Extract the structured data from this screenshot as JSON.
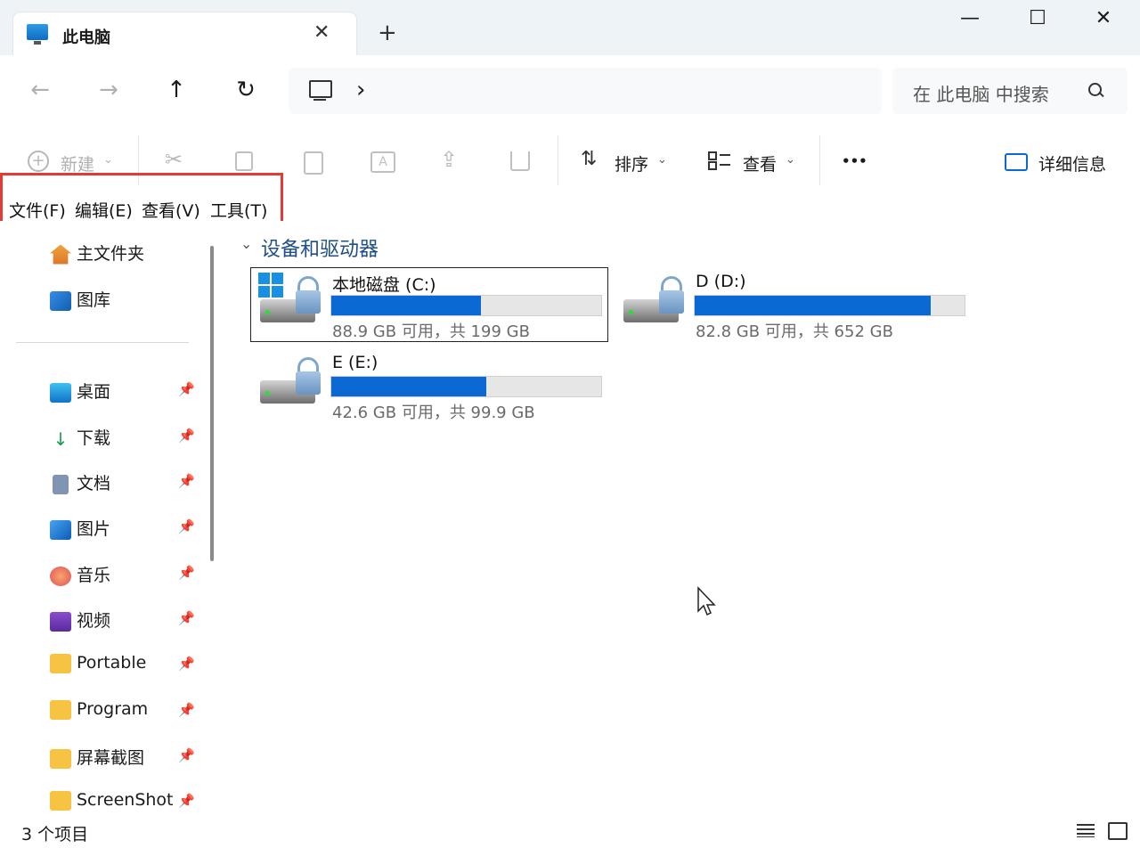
{
  "window": {
    "tab_title": "此电脑",
    "tab_close": "✕",
    "tab_add": "+",
    "minimize": "—",
    "maximize": "☐",
    "close": "✕"
  },
  "nav": {
    "back": "←",
    "forward": "→",
    "up": "↑",
    "refresh": "↻",
    "breadcrumb_sep": "›",
    "search_placeholder": "在 此电脑 中搜索"
  },
  "toolbar": {
    "new_label": "新建",
    "sort_label": "排序",
    "view_label": "查看",
    "more_label": "•••",
    "details_label": "详细信息"
  },
  "menubar": {
    "items": [
      "文件(F)",
      "编辑(E)",
      "查看(V)",
      "工具(T)"
    ]
  },
  "sidebar": {
    "items": [
      {
        "label": "主文件夹",
        "icon": "home-icon",
        "pinned": false
      },
      {
        "label": "图库",
        "icon": "gallery-icon",
        "pinned": false
      },
      {
        "label": "桌面",
        "icon": "desktop-icon",
        "pinned": true
      },
      {
        "label": "下载",
        "icon": "download-icon",
        "pinned": true
      },
      {
        "label": "文档",
        "icon": "document-icon",
        "pinned": true
      },
      {
        "label": "图片",
        "icon": "pictures-icon",
        "pinned": true
      },
      {
        "label": "音乐",
        "icon": "music-icon",
        "pinned": true
      },
      {
        "label": "视频",
        "icon": "video-icon",
        "pinned": true
      },
      {
        "label": "Portable",
        "icon": "folder-icon",
        "pinned": true
      },
      {
        "label": "Program",
        "icon": "folder-icon",
        "pinned": true
      },
      {
        "label": "屏幕截图",
        "icon": "folder-icon",
        "pinned": true
      },
      {
        "label": "ScreenShot",
        "icon": "folder-icon",
        "pinned": true
      }
    ]
  },
  "content": {
    "section_title": "设备和驱动器",
    "drives": [
      {
        "name": "本地磁盘 (C:)",
        "free": "88.9 GB 可用，共 199 GB",
        "used_fraction": 0.553,
        "selected": true,
        "system": true
      },
      {
        "name": "D (D:)",
        "free": "82.8 GB 可用，共 652 GB",
        "used_fraction": 0.873,
        "selected": false,
        "system": false
      },
      {
        "name": "E (E:)",
        "free": "42.6 GB 可用，共 99.9 GB",
        "used_fraction": 0.573,
        "selected": false,
        "system": false
      }
    ]
  },
  "status": {
    "item_count": "3 个项目"
  },
  "colors": {
    "accent": "#0a69d3",
    "highlight_box": "#e53935"
  }
}
